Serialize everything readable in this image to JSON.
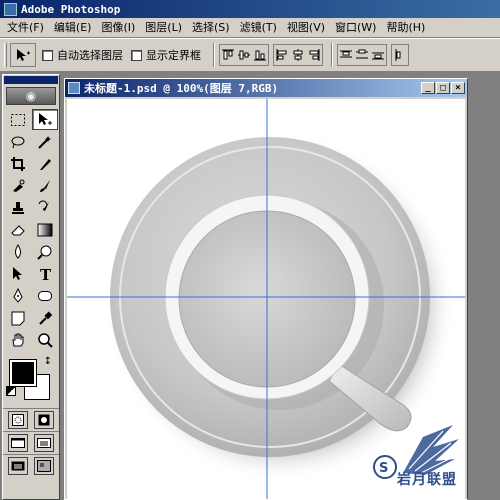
{
  "app": {
    "title": "Adobe Photoshop"
  },
  "menu": [
    "文件(F)",
    "编辑(E)",
    "图像(I)",
    "图层(L)",
    "选择(S)",
    "滤镜(T)",
    "视图(V)",
    "窗口(W)",
    "帮助(H)"
  ],
  "options": {
    "auto_select_layer": "自动选择图层",
    "show_bounding_box": "显示定界框",
    "auto_select_checked": false,
    "bounding_box_checked": false
  },
  "document": {
    "title": "未标题-1.psd @ 100%(图层 7,RGB)",
    "minimize": "_",
    "maximize": "□",
    "close": "×"
  },
  "colors": {
    "title_bar": "#0a246a",
    "ui_face": "#d4d0c8",
    "guide": "#3a6ee8",
    "foreground": "#000000",
    "background": "#ffffff"
  },
  "watermark": {
    "text": "岩月联盟"
  },
  "icons": {
    "move": "move-icon",
    "marquee": "marquee-icon",
    "lasso": "lasso-icon",
    "magic-wand": "magic-wand-icon",
    "crop": "crop-icon",
    "slice": "slice-icon",
    "healing": "healing-brush-icon",
    "brush": "brush-icon",
    "stamp": "clone-stamp-icon",
    "history-brush": "history-brush-icon",
    "eraser": "eraser-icon",
    "gradient": "gradient-icon",
    "blur": "blur-icon",
    "dodge": "dodge-icon",
    "path-select": "path-select-icon",
    "type": "type-icon",
    "pen": "pen-icon",
    "shape": "shape-icon",
    "notes": "notes-icon",
    "eyedropper": "eyedropper-icon",
    "hand": "hand-icon",
    "zoom": "zoom-icon"
  }
}
